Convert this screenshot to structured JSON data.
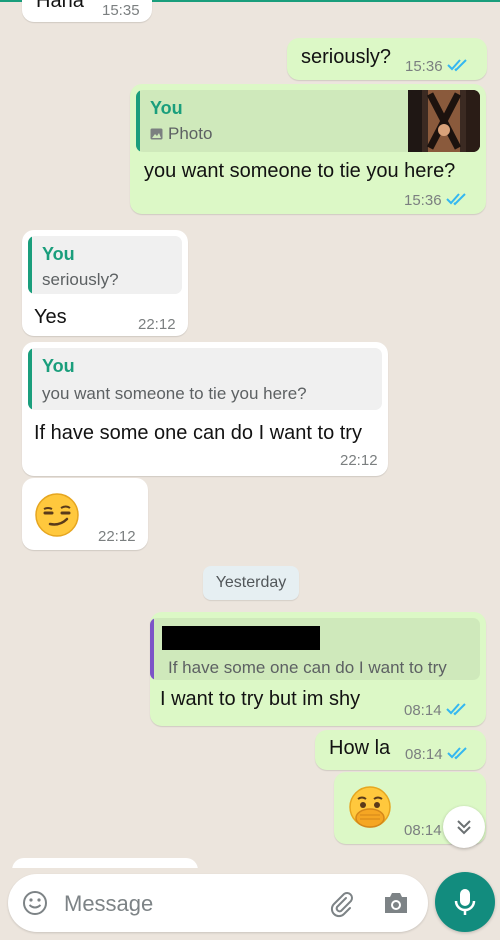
{
  "colors": {
    "background": "#ece5dd",
    "incoming_bubble": "#ffffff",
    "outgoing_bubble": "#dcf8c6",
    "accent_green": "#1a9e7c",
    "quote_bar_purple": "#7c55c7",
    "read_ticks": "#34b7f1",
    "mic_button": "#128c7e"
  },
  "messages": [
    {
      "direction": "incoming",
      "text": "Haha",
      "time": "15:35"
    },
    {
      "direction": "outgoing",
      "text": "seriously?",
      "time": "15:36",
      "status": "read"
    },
    {
      "direction": "outgoing",
      "quote": {
        "author": "You",
        "text": "Photo",
        "icon": "photo-icon"
      },
      "text": "you want someone to tie you here?",
      "time": "15:36",
      "status": "read"
    },
    {
      "direction": "incoming",
      "quote": {
        "author": "You",
        "text": "seriously?"
      },
      "text": "Yes",
      "time": "22:12"
    },
    {
      "direction": "incoming",
      "quote": {
        "author": "You",
        "text": "you want someone to tie you here?"
      },
      "text": "If have some one can do I want to try",
      "time": "22:12"
    },
    {
      "direction": "incoming",
      "emoji": "smirking-face",
      "time": "22:12"
    },
    {
      "direction": "outgoing",
      "quote": {
        "author": "",
        "text": "If have some one can do I want to try"
      },
      "text": "I want to try but im shy",
      "time": "08:14",
      "status": "read"
    },
    {
      "direction": "outgoing",
      "text": "How la",
      "time": "08:14",
      "status": "read"
    },
    {
      "direction": "outgoing",
      "emoji": "face-with-hand-over-mouth",
      "time": "08:14",
      "status": "read"
    }
  ],
  "date_separator": "Yesterday",
  "composer": {
    "placeholder": "Message"
  }
}
